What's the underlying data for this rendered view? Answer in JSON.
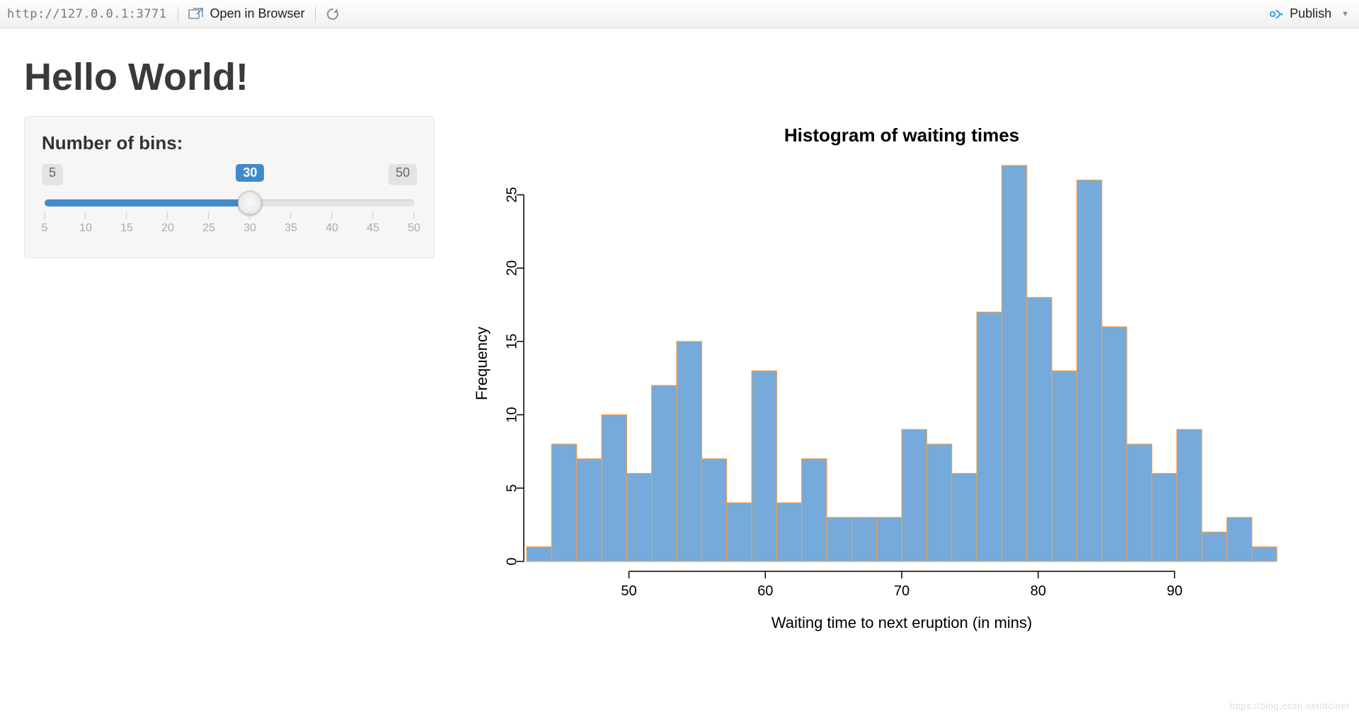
{
  "toolbar": {
    "url": "http://127.0.0.1:3771",
    "open_label": "Open in Browser",
    "publish_label": "Publish"
  },
  "page": {
    "title": "Hello World!"
  },
  "slider": {
    "label": "Number of bins:",
    "min": 5,
    "max": 50,
    "value": 30,
    "ticks": [
      5,
      10,
      15,
      20,
      25,
      30,
      35,
      40,
      45,
      50
    ]
  },
  "chart_data": {
    "type": "bar",
    "title": "Histogram of waiting times",
    "xlabel": "Waiting time to next eruption (in mins)",
    "ylabel": "Frequency",
    "xlim": [
      42.5,
      97.5
    ],
    "ylim": [
      0,
      27
    ],
    "bin_width": 1.8333,
    "categories": [
      43.42,
      45.25,
      47.08,
      48.92,
      50.75,
      52.58,
      54.42,
      56.25,
      58.08,
      59.92,
      61.75,
      63.58,
      65.42,
      67.25,
      69.08,
      70.92,
      72.75,
      74.58,
      76.42,
      78.25,
      80.08,
      81.92,
      83.75,
      85.58,
      87.42,
      89.25,
      91.08,
      92.92,
      94.75,
      96.58
    ],
    "values": [
      1,
      8,
      7,
      10,
      6,
      12,
      15,
      7,
      4,
      13,
      4,
      7,
      3,
      3,
      3,
      9,
      8,
      6,
      17,
      27,
      18,
      13,
      26,
      16,
      8,
      6,
      9,
      2,
      3,
      1
    ],
    "x_ticks": [
      50,
      60,
      70,
      80,
      90
    ],
    "y_ticks": [
      0,
      5,
      10,
      15,
      20,
      25
    ]
  },
  "watermark": "https://blog.csdn.net/dclnet"
}
